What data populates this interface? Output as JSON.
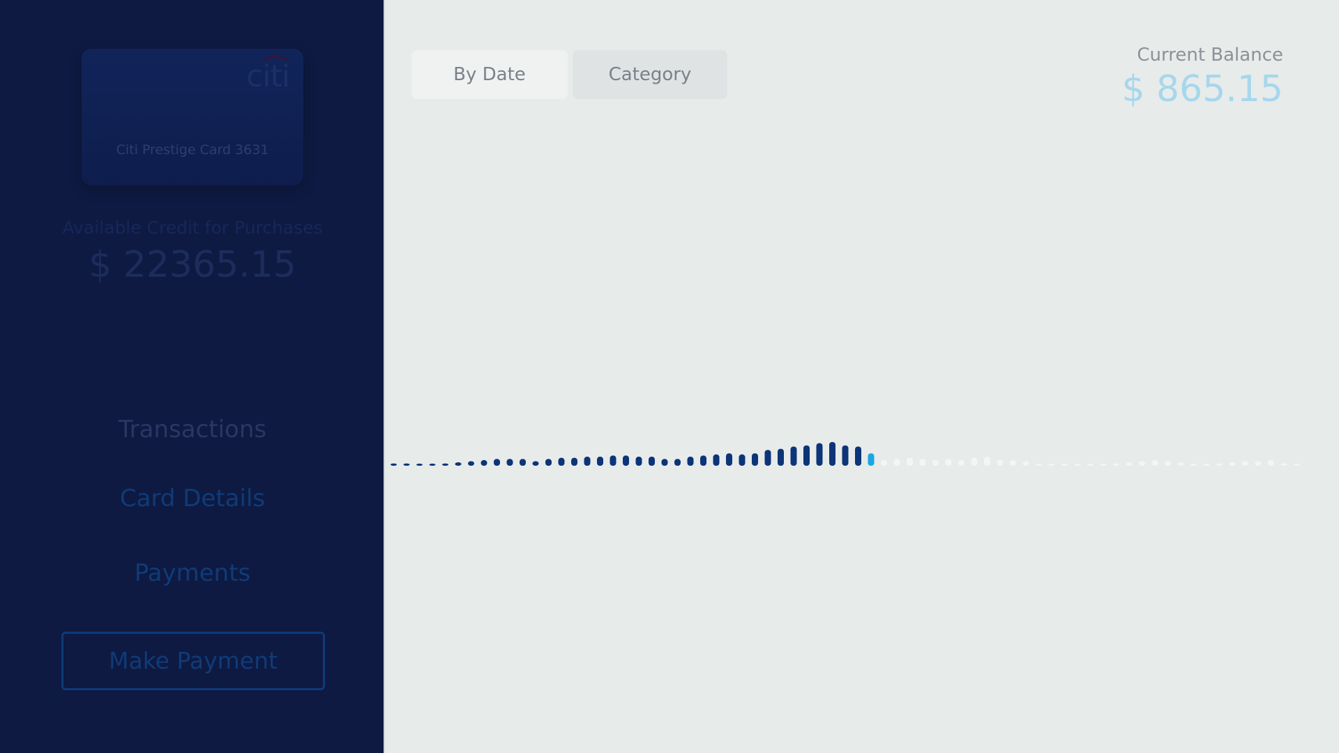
{
  "sidebar": {
    "card": {
      "logo": "citi",
      "name": "Citi Prestige Card 3631"
    },
    "credit_label": "Available Credit for Purchases",
    "credit_value": "$ 22365.15",
    "nav": {
      "transactions": "Transactions",
      "card_details": "Card Details",
      "payments": "Payments"
    },
    "make_payment_label": "Make Payment"
  },
  "main": {
    "tabs": {
      "by_date": "By Date",
      "category": "Category"
    },
    "balance_label": "Current Balance",
    "balance_value": "$ 865.15"
  },
  "colors": {
    "sidebar_bg": "#0e1a42",
    "main_bg": "#e7ebea",
    "bar_active": "#0c3478",
    "bar_selected": "#1aa6e4",
    "bar_future": "#f4f6f6",
    "balance_accent": "#a6d7ec"
  },
  "chart_data": {
    "type": "bar",
    "selected_index": 37,
    "values": [
      2,
      2,
      1,
      1,
      2,
      3,
      4,
      5,
      6,
      6,
      6,
      4,
      6,
      7,
      7,
      8,
      8,
      9,
      9,
      8,
      8,
      6,
      6,
      8,
      9,
      10,
      11,
      10,
      11,
      14,
      15,
      17,
      18,
      20,
      21,
      18,
      17,
      11,
      5,
      6,
      7,
      6,
      5,
      6,
      5,
      7,
      8,
      5,
      5,
      4,
      1,
      1,
      1,
      1,
      1,
      1,
      2,
      3,
      4,
      5,
      4,
      3,
      1,
      1,
      2,
      3,
      4,
      4,
      5,
      2,
      0
    ]
  }
}
